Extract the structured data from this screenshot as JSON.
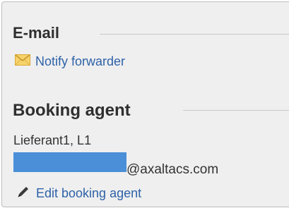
{
  "email_section": {
    "title": "E-mail",
    "notify_label": "Notify forwarder"
  },
  "booking_section": {
    "title": "Booking agent",
    "agent_name": "Lieferant1, L1",
    "email_suffix": "@axaltacs.com",
    "edit_label": "Edit booking agent"
  },
  "colors": {
    "panel_bg": "#efefef",
    "link": "#2e62a8",
    "redaction": "#4a8fd8"
  },
  "icons": [
    "envelope-icon",
    "pencil-icon"
  ]
}
